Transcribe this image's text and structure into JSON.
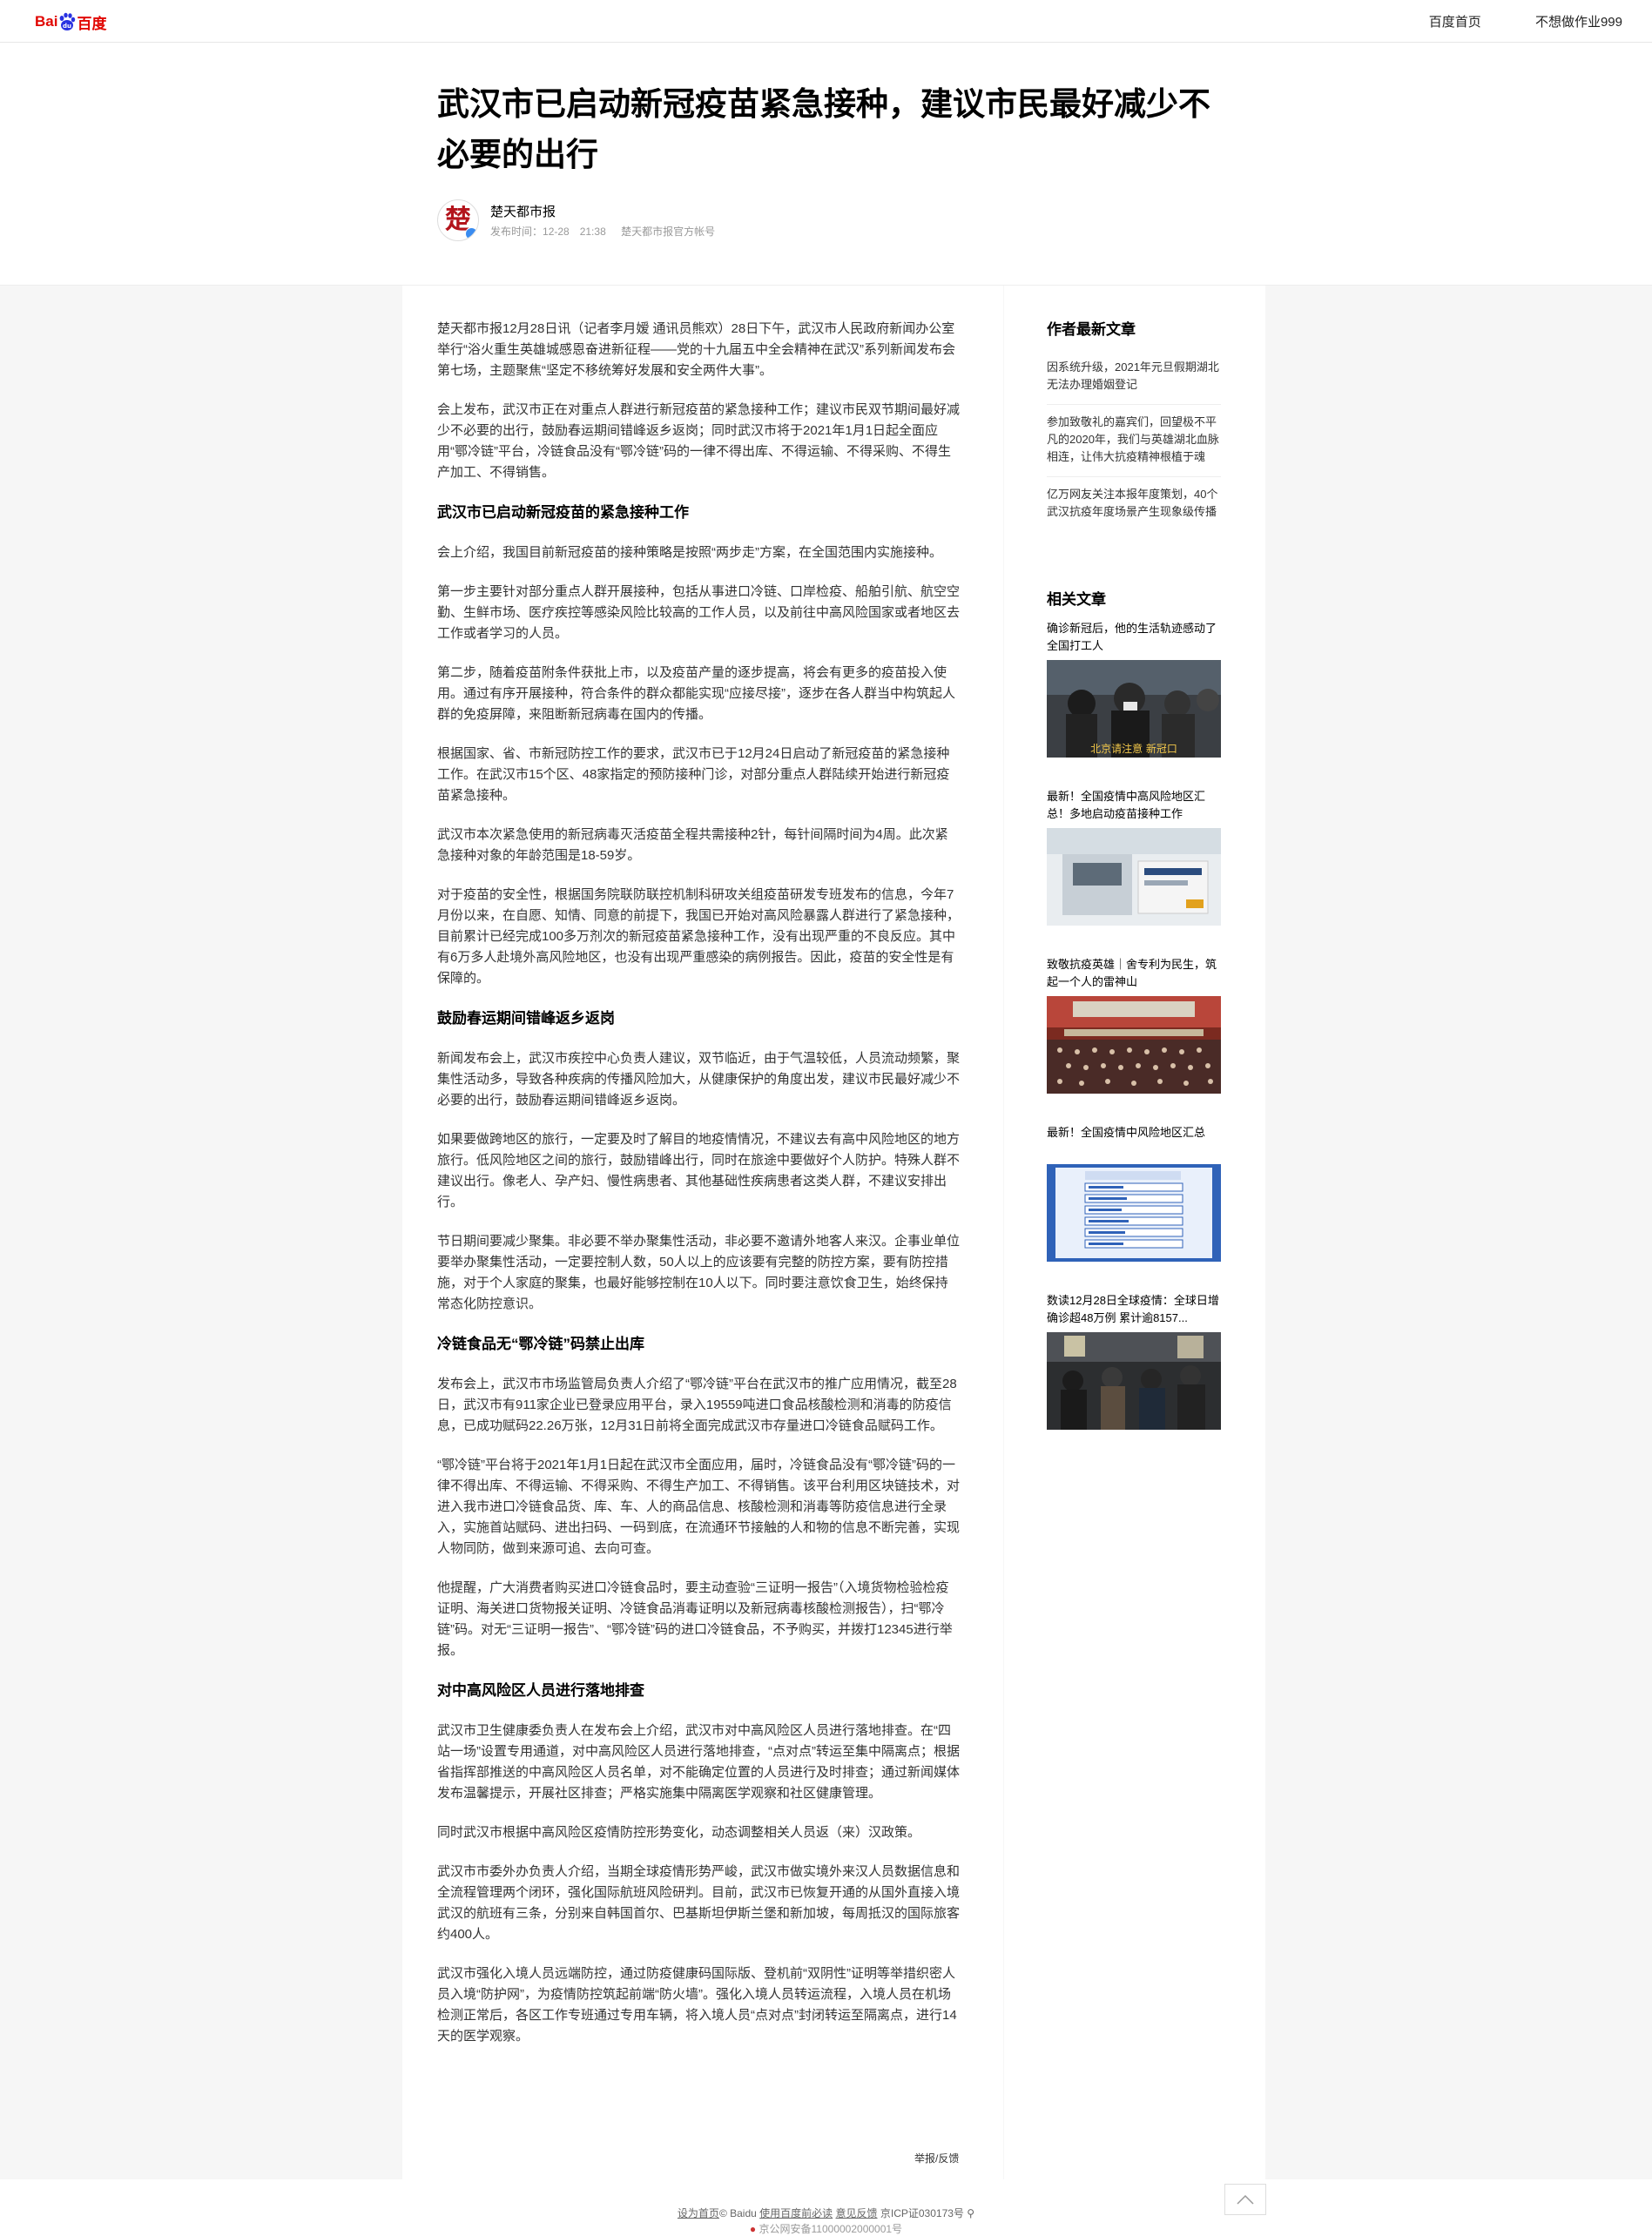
{
  "topbar": {
    "logo_left": "Bai",
    "logo_right": "百度",
    "nav": [
      "百度首页",
      "不想做作业999"
    ]
  },
  "article": {
    "title": "武汉市已启动新冠疫苗紧急接种，建议市民最好减少不必要的出行",
    "author": "楚天都市报",
    "publish_label": "发布时间：",
    "publish_time": "12-28　21:38",
    "account": "楚天都市报官方帐号",
    "report": "举报/反馈",
    "blocks": [
      {
        "type": "p",
        "text": "楚天都市报12月28日讯（记者李月嫒 通讯员熊欢）28日下午，武汉市人民政府新闻办公室举行“浴火重生英雄城感恩奋进新征程——党的十九届五中全会精神在武汉”系列新闻发布会第七场，主题聚焦“坚定不移统筹好发展和安全两件大事”。"
      },
      {
        "type": "p",
        "text": "会上发布，武汉市正在对重点人群进行新冠疫苗的紧急接种工作；建议市民双节期间最好减少不必要的出行，鼓励春运期间错峰返乡返岗；同时武汉市将于2021年1月1日起全面应用“鄂冷链”平台，冷链食品没有“鄂冷链”码的一律不得出库、不得运输、不得采购、不得生产加工、不得销售。"
      },
      {
        "type": "h",
        "text": "武汉市已启动新冠疫苗的紧急接种工作"
      },
      {
        "type": "p",
        "text": "会上介绍，我国目前新冠疫苗的接种策略是按照“两步走”方案，在全国范围内实施接种。"
      },
      {
        "type": "p",
        "text": "第一步主要针对部分重点人群开展接种，包括从事进口冷链、口岸检疫、船舶引航、航空空勤、生鲜市场、医疗疾控等感染风险比较高的工作人员，以及前往中高风险国家或者地区去工作或者学习的人员。"
      },
      {
        "type": "p",
        "text": "第二步，随着疫苗附条件获批上市，以及疫苗产量的逐步提高，将会有更多的疫苗投入使用。通过有序开展接种，符合条件的群众都能实现“应接尽接”，逐步在各人群当中构筑起人群的免疫屏障，来阻断新冠病毒在国内的传播。"
      },
      {
        "type": "p",
        "text": "根据国家、省、市新冠防控工作的要求，武汉市已于12月24日启动了新冠疫苗的紧急接种工作。在武汉市15个区、48家指定的预防接种门诊，对部分重点人群陆续开始进行新冠疫苗紧急接种。"
      },
      {
        "type": "p",
        "text": "武汉市本次紧急使用的新冠病毒灭活疫苗全程共需接种2针，每针间隔时间为4周。此次紧急接种对象的年龄范围是18-59岁。"
      },
      {
        "type": "p",
        "text": "对于疫苗的安全性，根据国务院联防联控机制科研攻关组疫苗研发专班发布的信息，今年7月份以来，在自愿、知情、同意的前提下，我国已开始对高风险暴露人群进行了紧急接种，目前累计已经完成100多万剂次的新冠疫苗紧急接种工作，没有出现严重的不良反应。其中有6万多人赴境外高风险地区，也没有出现严重感染的病例报告。因此，疫苗的安全性是有保障的。"
      },
      {
        "type": "h",
        "text": "鼓励春运期间错峰返乡返岗"
      },
      {
        "type": "p",
        "text": "新闻发布会上，武汉市疾控中心负责人建议，双节临近，由于气温较低，人员流动频繁，聚集性活动多，导致各种疾病的传播风险加大，从健康保护的角度出发，建议市民最好减少不必要的出行，鼓励春运期间错峰返乡返岗。"
      },
      {
        "type": "p",
        "text": "如果要做跨地区的旅行，一定要及时了解目的地疫情情况，不建议去有高中风险地区的地方旅行。低风险地区之间的旅行，鼓励错峰出行，同时在旅途中要做好个人防护。特殊人群不建议出行。像老人、孕产妇、慢性病患者、其他基础性疾病患者这类人群，不建议安排出行。"
      },
      {
        "type": "p",
        "text": "节日期间要减少聚集。非必要不举办聚集性活动，非必要不邀请外地客人来汉。企事业单位要举办聚集性活动，一定要控制人数，50人以上的应该要有完整的防控方案，要有防控措施，对于个人家庭的聚集，也最好能够控制在10人以下。同时要注意饮食卫生，始终保持常态化防控意识。"
      },
      {
        "type": "h",
        "text": "冷链食品无“鄂冷链”码禁止出库"
      },
      {
        "type": "p",
        "text": "发布会上，武汉市市场监管局负责人介绍了“鄂冷链”平台在武汉市的推广应用情况，截至28日，武汉市有911家企业已登录应用平台，录入19559吨进口食品核酸检测和消毒的防疫信息，已成功赋码22.26万张，12月31日前将全面完成武汉市存量进口冷链食品赋码工作。"
      },
      {
        "type": "p",
        "text": "“鄂冷链”平台将于2021年1月1日起在武汉市全面应用，届时，冷链食品没有“鄂冷链”码的一律不得出库、不得运输、不得采购、不得生产加工、不得销售。该平台利用区块链技术，对进入我市进口冷链食品货、库、车、人的商品信息、核酸检测和消毒等防疫信息进行全录入，实施首站赋码、进出扫码、一码到底，在流通环节接触的人和物的信息不断完善，实现人物同防，做到来源可追、去向可查。"
      },
      {
        "type": "p",
        "text": "他提醒，广大消费者购买进口冷链食品时，要主动查验“三证明一报告”（入境货物检验检疫证明、海关进口货物报关证明、冷链食品消毒证明以及新冠病毒核酸检测报告），扫“鄂冷链”码。对无“三证明一报告”、“鄂冷链”码的进口冷链食品，不予购买，并拨打12345进行举报。"
      },
      {
        "type": "h",
        "text": "对中高风险区人员进行落地排查"
      },
      {
        "type": "p",
        "text": "武汉市卫生健康委负责人在发布会上介绍，武汉市对中高风险区人员进行落地排查。在“四站一场”设置专用通道，对中高风险区人员进行落地排查，“点对点”转运至集中隔离点；根据省指挥部推送的中高风险区人员名单，对不能确定位置的人员进行及时排查；通过新闻媒体发布温馨提示，开展社区排查；严格实施集中隔离医学观察和社区健康管理。"
      },
      {
        "type": "p",
        "text": "同时武汉市根据中高风险区疫情防控形势变化，动态调整相关人员返（来）汉政策。"
      },
      {
        "type": "p",
        "text": "武汉市市委外办负责人介绍，当期全球疫情形势严峻，武汉市做实境外来汉人员数据信息和全流程管理两个闭环，强化国际航班风险研判。目前，武汉市已恢复开通的从国外直接入境武汉的航班有三条，分别来自韩国首尔、巴基斯坦伊斯兰堡和新加坡，每周抵汉的国际旅客约400人。"
      },
      {
        "type": "p",
        "text": "武汉市强化入境人员远端防控，通过防疫健康码国际版、登机前“双阴性”证明等举措织密人员入境“防护网”，为疫情防控筑起前端“防火墙”。强化入境人员转运流程，入境人员在机场检测正常后，各区工作专班通过专用车辆，将入境人员“点对点”封闭转运至隔离点，进行14天的医学观察。"
      }
    ]
  },
  "sidebar": {
    "latest_title": "作者最新文章",
    "latest": [
      "因系统升级，2021年元旦假期湖北无法办理婚姻登记",
      "参加致敬礼的嘉宾们，回望极不平凡的2020年，我们与英雄湖北血脉相连，让伟大抗疫精神根植于魂",
      "亿万网友关注本报年度策划，40个武汉抗疫年度场景产生现象级传播"
    ],
    "related_title": "相关文章",
    "related": [
      "确诊新冠后，他的生活轨迹感动了全国打工人",
      "最新！全国疫情中高风险地区汇总！多地启动疫苗接种工作",
      "致敬抗疫英雄｜舍专利为民生，筑起一个人的雷神山",
      "最新！全国疫情中风险地区汇总",
      "数读12月28日全球疫情：全球日增确诊超48万例 累计逾8157..."
    ],
    "thumb_caption": "北京请注意 新冠口"
  },
  "footer": {
    "home": "设为首页",
    "copyright": "© Baidu",
    "must_read": "使用百度前必读",
    "feedback": "意见反馈",
    "icp": "京ICP证030173号",
    "police": "京公网安备11000002000001号"
  }
}
